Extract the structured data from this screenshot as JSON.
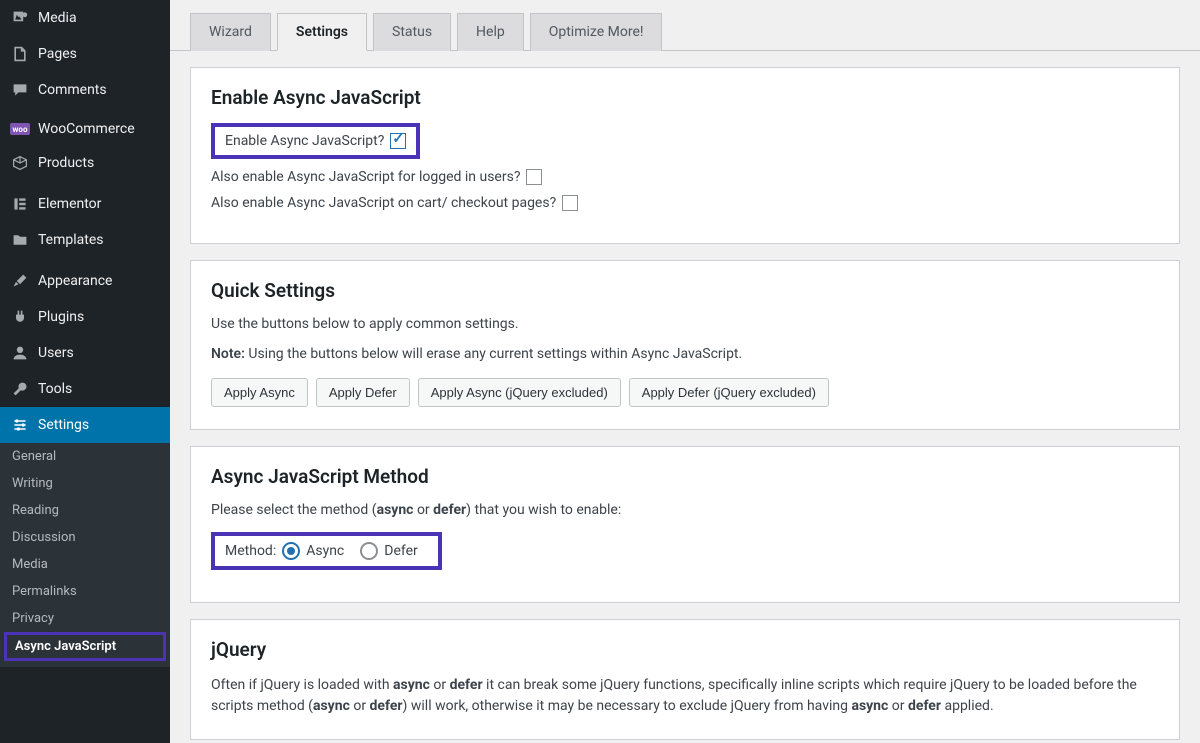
{
  "sidebar": {
    "items": [
      {
        "label": "Media",
        "icon": "media"
      },
      {
        "label": "Pages",
        "icon": "page"
      },
      {
        "label": "Comments",
        "icon": "comment"
      },
      {
        "label": "WooCommerce",
        "icon": "woo"
      },
      {
        "label": "Products",
        "icon": "box"
      },
      {
        "label": "Elementor",
        "icon": "elementor"
      },
      {
        "label": "Templates",
        "icon": "folder"
      },
      {
        "label": "Appearance",
        "icon": "brush"
      },
      {
        "label": "Plugins",
        "icon": "plug"
      },
      {
        "label": "Users",
        "icon": "user"
      },
      {
        "label": "Tools",
        "icon": "wrench"
      },
      {
        "label": "Settings",
        "icon": "sliders",
        "active": true
      }
    ],
    "sub": [
      "General",
      "Writing",
      "Reading",
      "Discussion",
      "Media",
      "Permalinks",
      "Privacy",
      "Async JavaScript"
    ]
  },
  "tabs": [
    "Wizard",
    "Settings",
    "Status",
    "Help",
    "Optimize More!"
  ],
  "activeTab": "Settings",
  "panel1": {
    "heading": "Enable Async JavaScript",
    "row1": "Enable Async JavaScript?",
    "row2": "Also enable Async JavaScript for logged in users?",
    "row3": "Also enable Async JavaScript on cart/ checkout pages?"
  },
  "panel2": {
    "heading": "Quick Settings",
    "desc": "Use the buttons below to apply common settings.",
    "note_bold": "Note:",
    "note_rest": " Using the buttons below will erase any current settings within Async JavaScript.",
    "buttons": [
      "Apply Async",
      "Apply Defer",
      "Apply Async (jQuery excluded)",
      "Apply Defer (jQuery excluded)"
    ]
  },
  "panel3": {
    "heading": "Async JavaScript Method",
    "desc_pre": "Please select the method (",
    "desc_b1": "async",
    "desc_mid": " or ",
    "desc_b2": "defer",
    "desc_post": ") that you wish to enable:",
    "method_label": "Method:",
    "opt1": "Async",
    "opt2": "Defer"
  },
  "panel4": {
    "heading": "jQuery",
    "p_parts": {
      "t1": "Often if jQuery is loaded with ",
      "b1": "async",
      "t2": " or ",
      "b2": "defer",
      "t3": " it can break some jQuery functions, specifically inline scripts which require jQuery to be loaded before the scripts method (",
      "b3": "async",
      "t4": " or ",
      "b4": "defer",
      "t5": ") will work, otherwise it may be necessary to exclude jQuery from having ",
      "b5": "async",
      "t6": " or ",
      "b6": "defer",
      "t7": " applied."
    }
  }
}
